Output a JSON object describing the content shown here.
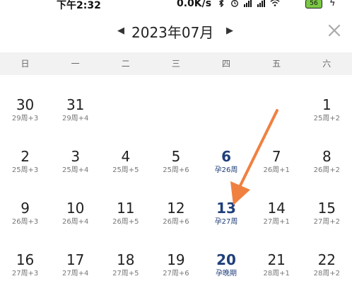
{
  "status": {
    "time": "下午2:32",
    "network": "0.0K/s",
    "battery": "56",
    "icons": [
      "bluetooth-icon",
      "alarm-icon",
      "signal-icon",
      "signal-icon",
      "wifi-icon",
      "battery-icon",
      "charging-icon"
    ]
  },
  "header": {
    "title": "2023年07月",
    "prev_icon": "triangle-left",
    "next_icon": "triangle-right",
    "close_icon": "close-x"
  },
  "weekdays": [
    "日",
    "一",
    "二",
    "三",
    "四",
    "五",
    "六"
  ],
  "weeks": [
    [
      {
        "day": "30",
        "sub": "29周+3"
      },
      {
        "day": "31",
        "sub": "29周+4"
      },
      {
        "day": "",
        "sub": ""
      },
      {
        "day": "",
        "sub": ""
      },
      {
        "day": "",
        "sub": ""
      },
      {
        "day": "",
        "sub": ""
      },
      {
        "day": "1",
        "sub": "25周+2"
      }
    ],
    [
      {
        "day": "2",
        "sub": "25周+3"
      },
      {
        "day": "3",
        "sub": "25周+4"
      },
      {
        "day": "4",
        "sub": "25周+5"
      },
      {
        "day": "5",
        "sub": "25周+6"
      },
      {
        "day": "6",
        "sub": "孕26周",
        "highlight": true
      },
      {
        "day": "7",
        "sub": "26周+1"
      },
      {
        "day": "8",
        "sub": "26周+2"
      }
    ],
    [
      {
        "day": "9",
        "sub": "26周+3"
      },
      {
        "day": "10",
        "sub": "26周+4"
      },
      {
        "day": "11",
        "sub": "26周+5"
      },
      {
        "day": "12",
        "sub": "26周+6"
      },
      {
        "day": "13",
        "sub": "孕27周",
        "highlight": true
      },
      {
        "day": "14",
        "sub": "27周+1"
      },
      {
        "day": "15",
        "sub": "27周+2"
      }
    ],
    [
      {
        "day": "16",
        "sub": "27周+3"
      },
      {
        "day": "17",
        "sub": "27周+4"
      },
      {
        "day": "18",
        "sub": "27周+5"
      },
      {
        "day": "19",
        "sub": "27周+6"
      },
      {
        "day": "20",
        "sub": "孕晚期",
        "highlight": true
      },
      {
        "day": "21",
        "sub": "28周+1"
      },
      {
        "day": "22",
        "sub": "28周+2"
      }
    ]
  ],
  "colors": {
    "highlight": "#1f3f7a",
    "weekday_bg": "#f2f2f2",
    "annotation_arrow": "#f08040"
  }
}
